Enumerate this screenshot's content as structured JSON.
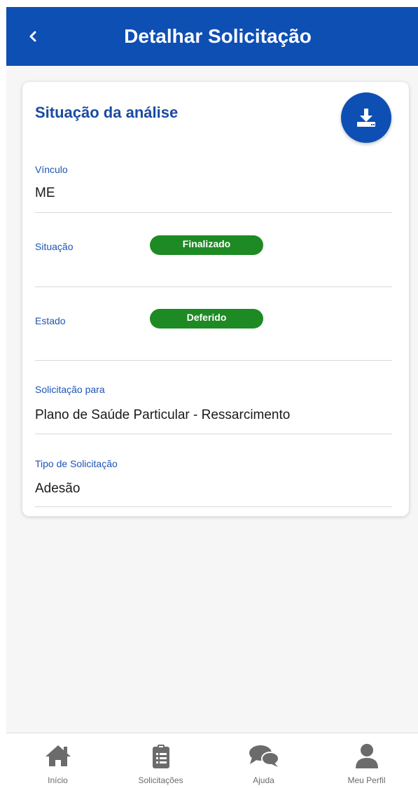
{
  "header": {
    "title": "Detalhar Solicitação"
  },
  "card": {
    "title": "Situação da análise",
    "fields": {
      "vinculo": {
        "label": "Vínculo",
        "value": "ME"
      },
      "situacao": {
        "label": "Situação",
        "badge": "Finalizado"
      },
      "estado": {
        "label": "Estado",
        "badge": "Deferido"
      },
      "solicitacao_para": {
        "label": "Solicitação para",
        "value": "Plano de Saúde Particular - Ressarcimento"
      },
      "tipo": {
        "label": "Tipo de Solicitação",
        "value": "Adesão"
      }
    }
  },
  "nav": {
    "items": [
      {
        "label": "Início",
        "icon": "home-icon"
      },
      {
        "label": "Solicitações",
        "icon": "clipboard-icon"
      },
      {
        "label": "Ajuda",
        "icon": "chat-icon"
      },
      {
        "label": "Meu Perfil",
        "icon": "user-icon"
      }
    ]
  },
  "colors": {
    "primary": "#0e4fb4",
    "label": "#1e55b3",
    "badge_success": "#1e8a24",
    "nav_icon": "#6b6b6b"
  }
}
